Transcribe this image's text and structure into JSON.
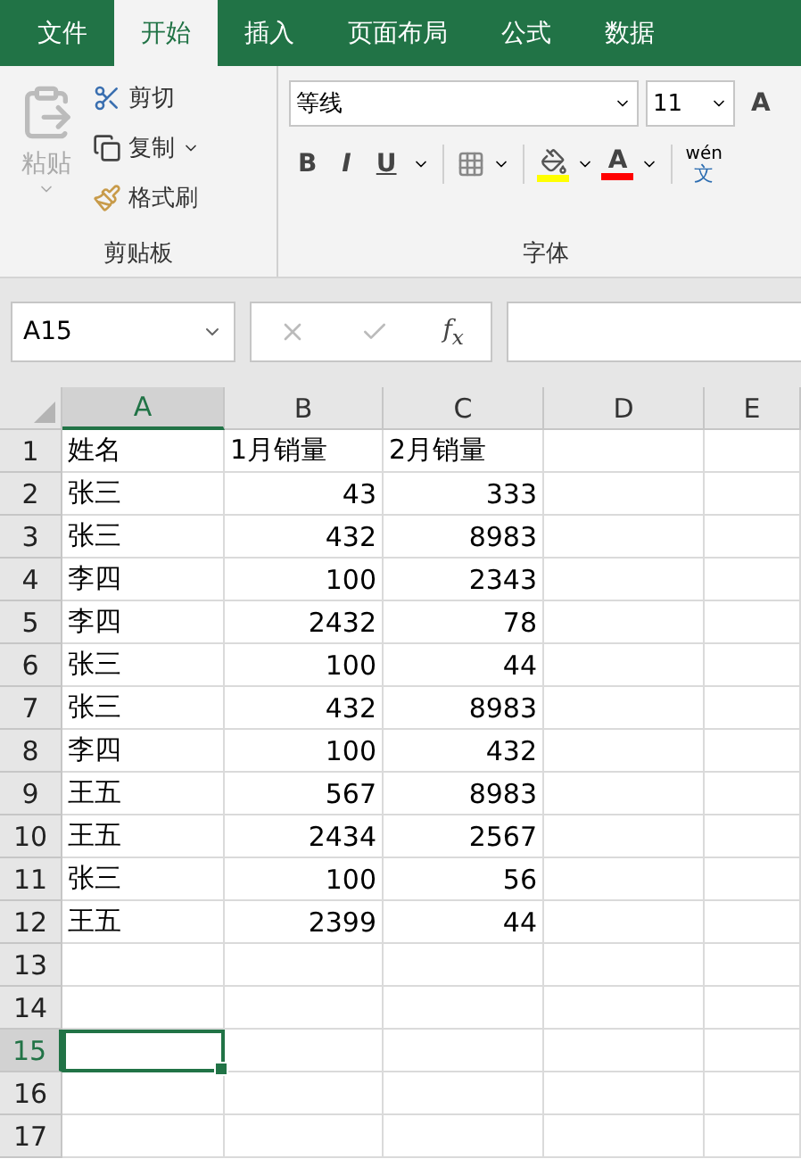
{
  "tabs": [
    {
      "label": "文件",
      "selected": false
    },
    {
      "label": "开始",
      "selected": true
    },
    {
      "label": "插入",
      "selected": false
    },
    {
      "label": "页面布局",
      "selected": false
    },
    {
      "label": "公式",
      "selected": false
    },
    {
      "label": "数据",
      "selected": false
    }
  ],
  "clipboard": {
    "paste": "粘贴",
    "cut": "剪切",
    "copy": "复制",
    "format_painter": "格式刷",
    "label": "剪贴板"
  },
  "font": {
    "name": "等线",
    "size": "11",
    "grow": "A",
    "bold": "B",
    "italic": "I",
    "underline": "U",
    "color_letter": "A",
    "phonetic_top": "wén",
    "phonetic_bottom": "文",
    "label": "字体"
  },
  "formula_bar": {
    "name_box": "A15",
    "fx": "f$_{x}$"
  },
  "columns": [
    {
      "label": "A",
      "selected": true
    },
    {
      "label": "B",
      "selected": false
    },
    {
      "label": "C",
      "selected": false
    },
    {
      "label": "D",
      "selected": false
    },
    {
      "label": "E",
      "selected": false
    }
  ],
  "rows": [
    {
      "number": "1",
      "selected": false,
      "cells": [
        "姓名",
        "1月销量",
        "2月销量"
      ]
    },
    {
      "number": "2",
      "selected": false,
      "cells": [
        "张三",
        "43",
        "333"
      ]
    },
    {
      "number": "3",
      "selected": false,
      "cells": [
        "张三",
        "432",
        "8983"
      ]
    },
    {
      "number": "4",
      "selected": false,
      "cells": [
        "李四",
        "100",
        "2343"
      ]
    },
    {
      "number": "5",
      "selected": false,
      "cells": [
        "李四",
        "2432",
        "78"
      ]
    },
    {
      "number": "6",
      "selected": false,
      "cells": [
        "张三",
        "100",
        "44"
      ]
    },
    {
      "number": "7",
      "selected": false,
      "cells": [
        "张三",
        "432",
        "8983"
      ]
    },
    {
      "number": "8",
      "selected": false,
      "cells": [
        "李四",
        "100",
        "432"
      ]
    },
    {
      "number": "9",
      "selected": false,
      "cells": [
        "王五",
        "567",
        "8983"
      ]
    },
    {
      "number": "10",
      "selected": false,
      "cells": [
        "王五",
        "2434",
        "2567"
      ]
    },
    {
      "number": "11",
      "selected": false,
      "cells": [
        "张三",
        "100",
        "56"
      ]
    },
    {
      "number": "12",
      "selected": false,
      "cells": [
        "王五",
        "2399",
        "44"
      ]
    },
    {
      "number": "13",
      "selected": false,
      "cells": []
    },
    {
      "number": "14",
      "selected": false,
      "cells": []
    },
    {
      "number": "15",
      "selected": true,
      "cells": []
    },
    {
      "number": "16",
      "selected": false,
      "cells": []
    },
    {
      "number": "17",
      "selected": false,
      "cells": []
    }
  ]
}
